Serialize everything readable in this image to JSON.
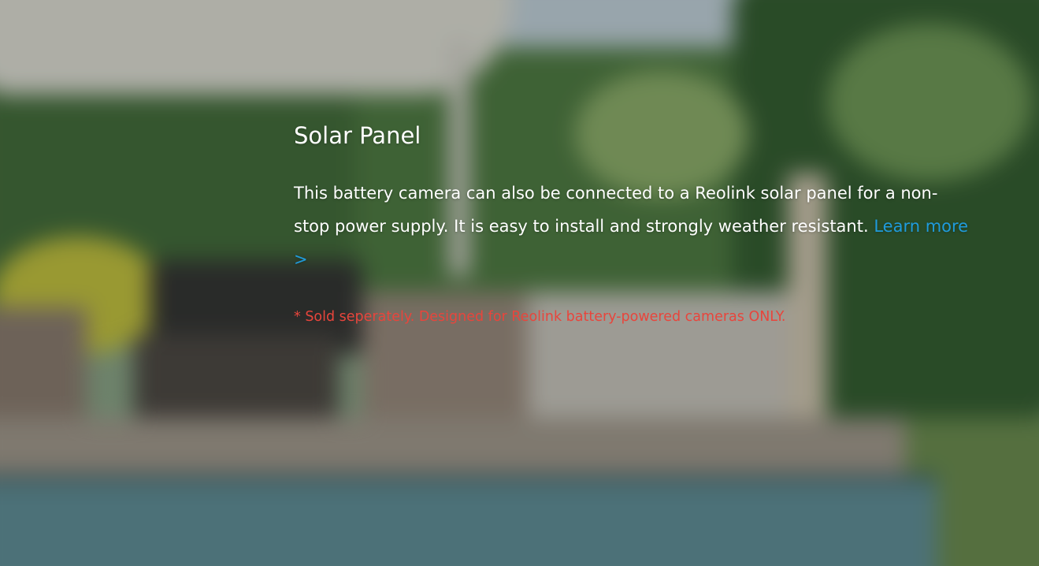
{
  "section": {
    "title": "Solar Panel",
    "description": "This battery camera can also be connected to a Reolink solar panel for a non-stop power supply. It is easy to install and strongly weather resistant.",
    "learn_more": "Learn more >",
    "note": "* Sold seperately. Designed for Reolink battery-powered cameras ONLY."
  },
  "colors": {
    "link": "#1f9bdc",
    "note": "#e8453c",
    "text": "#ffffff"
  }
}
